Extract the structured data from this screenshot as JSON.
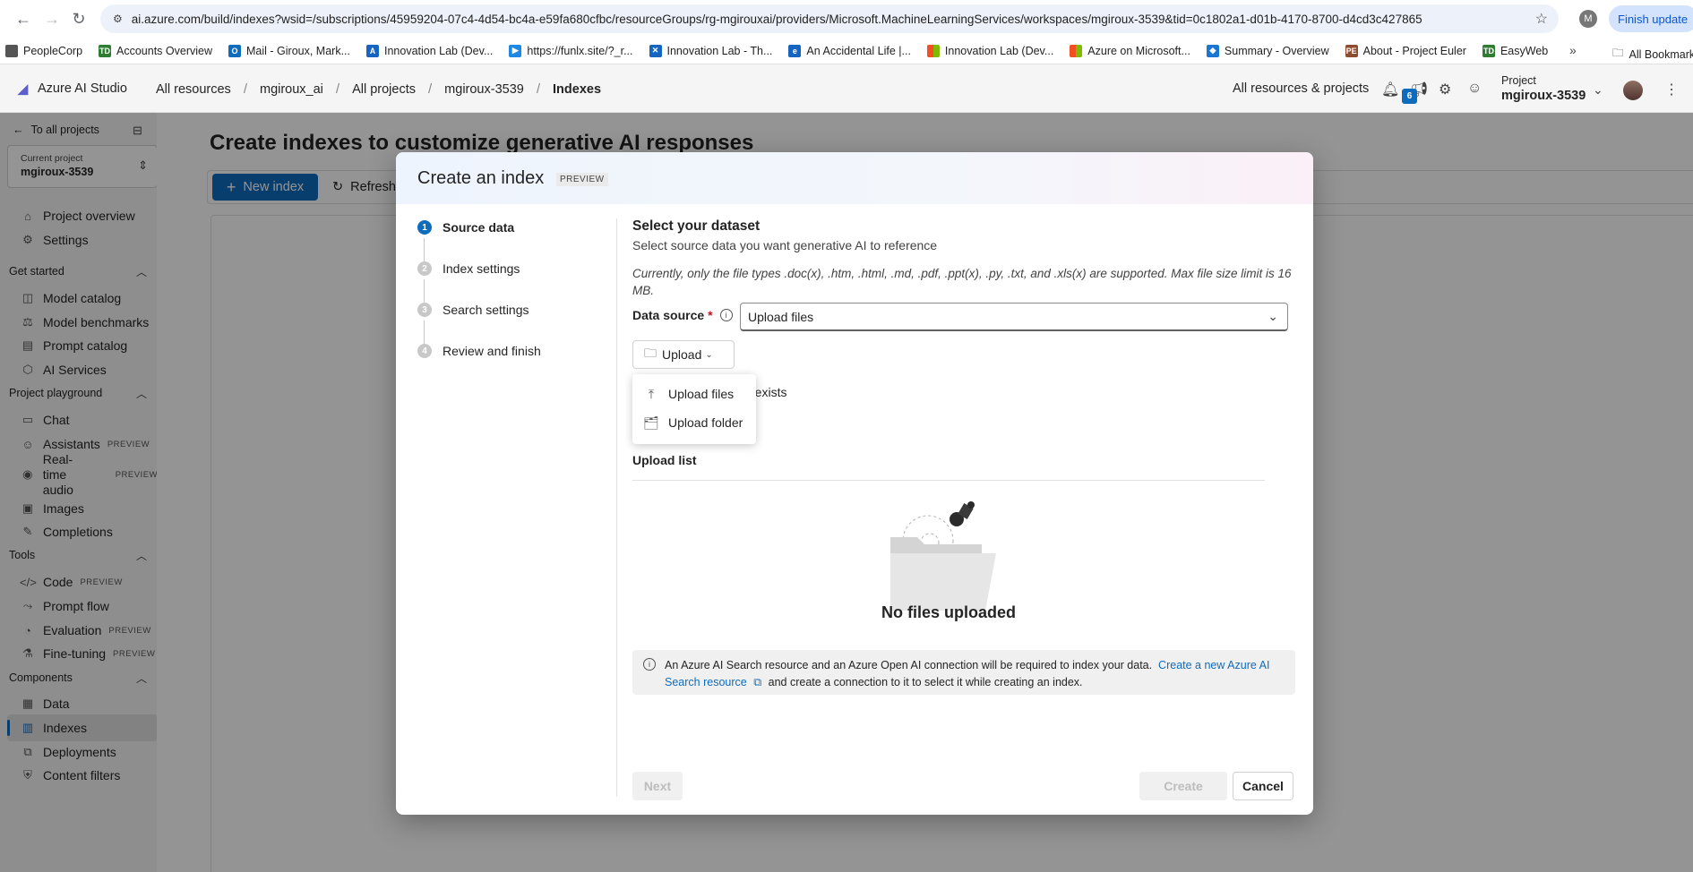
{
  "browser": {
    "url": "ai.azure.com/build/indexes?wsid=/subscriptions/45959204-07c4-4d54-bc4a-e59fa680cfbc/resourceGroups/rg-mgirouxai/providers/Microsoft.MachineLearningServices/workspaces/mgiroux-3539&tid=0c1802a1-d01b-4170-8700-d4cd3c427865",
    "profile_initial": "M",
    "finish_update": "Finish update",
    "bookmarks": [
      "PeopleCorp",
      "Accounts Overview",
      "Mail - Giroux, Mark...",
      "Innovation Lab (Dev...",
      "https://funlx.site/?_r...",
      "Innovation Lab - Th...",
      "An Accidental Life |...",
      "Innovation Lab (Dev...",
      "Azure on Microsoft...",
      "Summary - Overview",
      "About - Project Euler",
      "EasyWeb"
    ],
    "all_bookmarks": "All Bookmarks"
  },
  "header": {
    "brand": "Azure AI Studio",
    "breadcrumbs": [
      "All resources",
      "mgiroux_ai",
      "All projects",
      "mgiroux-3539",
      "Indexes"
    ],
    "all_resources_projects": "All resources & projects",
    "notif_count": "6",
    "project_label": "Project",
    "project_name": "mgiroux-3539"
  },
  "sidebar": {
    "back": "To all projects",
    "current_project_label": "Current project",
    "current_project": "mgiroux-3539",
    "items_top": [
      "Project overview",
      "Settings"
    ],
    "sections": {
      "get_started": "Get started",
      "playground": "Project playground",
      "tools": "Tools",
      "components": "Components"
    },
    "get_started": [
      "Model catalog",
      "Model benchmarks",
      "Prompt catalog",
      "AI Services"
    ],
    "playground": [
      "Chat",
      "Assistants",
      "Real-time audio",
      "Images",
      "Completions"
    ],
    "tools": [
      "Code",
      "Prompt flow",
      "Evaluation",
      "Fine-tuning"
    ],
    "components": [
      "Data",
      "Indexes",
      "Deployments",
      "Content filters"
    ],
    "preview": "PREVIEW"
  },
  "main": {
    "title": "Create indexes to customize generative AI responses",
    "new_index": "New index",
    "refresh": "Refresh"
  },
  "dialog": {
    "title": "Create an index",
    "preview": "PREVIEW",
    "steps": [
      "Source data",
      "Index settings",
      "Search settings",
      "Review and finish"
    ],
    "section_title": "Select your dataset",
    "section_sub": "Select source data you want generative AI to reference",
    "note": "Currently, only the file types .doc(x), .htm, .html, .md, .pdf, .ppt(x), .py, .txt, and .xls(x) are supported. Max file size limit is 16 MB.",
    "data_source_label": "Data source",
    "data_source_value": "Upload files",
    "upload_label": "Upload",
    "menu": [
      "Upload files",
      "Upload folder"
    ],
    "overwrite_fragment": "dy exists",
    "upload_list": "Upload list",
    "no_files": "No files uploaded",
    "info_text": "An Azure AI Search resource and an Azure Open AI connection will be required to index your data.",
    "info_link": "Create a new Azure AI Search resource",
    "info_tail": "and create a connection to it to select it while creating an index.",
    "next": "Next",
    "create": "Create",
    "cancel": "Cancel"
  }
}
